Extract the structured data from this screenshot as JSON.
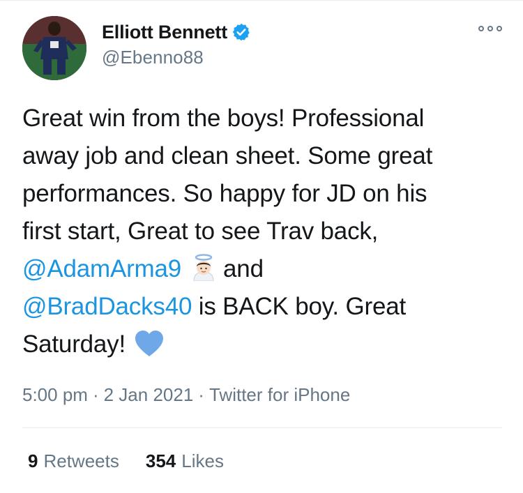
{
  "tweet": {
    "author": {
      "display_name": "Elliott Bennett",
      "handle": "@Ebenno88",
      "verified": true,
      "avatar_icon": "avatar-photo"
    },
    "more_icon": "more-options-icon",
    "text_lines": [
      [
        {
          "t": "Great win from the boys! Professional"
        }
      ],
      [
        {
          "t": "away job and clean sheet. Some great"
        }
      ],
      [
        {
          "t": "performances. So happy for JD on his"
        }
      ],
      [
        {
          "t": "first start, Great to see Trav back,"
        }
      ],
      [
        {
          "t": "@AdamArma9",
          "mention": true
        },
        {
          "emoji": "angel-emoji"
        },
        {
          "t": "and"
        }
      ],
      [
        {
          "t": "@BradDacks40",
          "mention": true
        },
        {
          "t": " is BACK boy. Great"
        }
      ],
      [
        {
          "t": "Saturday!"
        },
        {
          "emoji": "blue-heart-emoji"
        }
      ]
    ],
    "time": "5:00 pm",
    "date": "2 Jan 2021",
    "source": "Twitter for iPhone",
    "separator": "·",
    "retweets_count": "9",
    "retweets_label": "Retweets",
    "likes_count": "354",
    "likes_label": "Likes"
  },
  "colors": {
    "mention": "#1b95e0",
    "secondary_text": "#657786",
    "primary_text": "#14171a",
    "verified_badge": "#1da1f2",
    "heart": "#6fa8e8"
  }
}
